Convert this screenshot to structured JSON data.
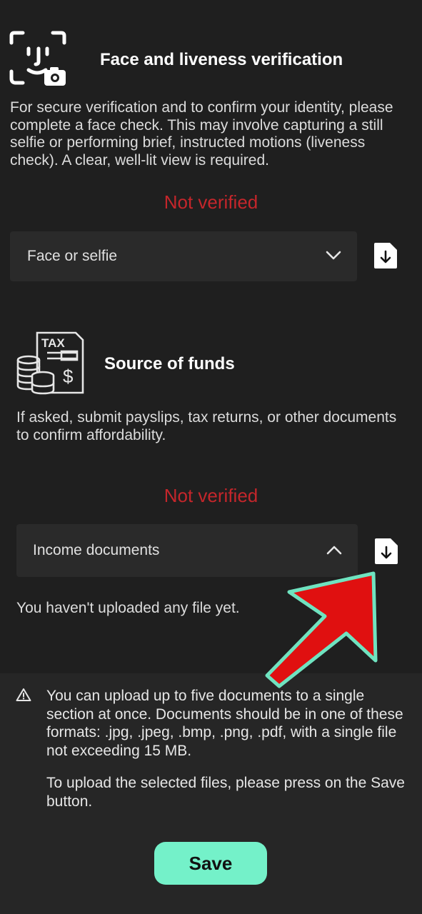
{
  "face": {
    "title": "Face and liveness verification",
    "description": "For secure verification and to confirm your identity, please complete a face check. This may involve capturing a still selfie or performing brief, instructed motions (liveness check). A clear, well-lit view is required.",
    "status": "Not verified",
    "select_value": "Face or selfie"
  },
  "funds": {
    "title": "Source of funds",
    "icon_text": "TAX",
    "description": "If asked, submit payslips, tax returns, or other documents to confirm affordability.",
    "status": "Not verified",
    "select_value": "Income documents",
    "empty_message": "You haven't uploaded any file yet."
  },
  "notice": {
    "line1": "You can upload up to five documents to a single section at once. Documents should be in one of these formats: .jpg, .jpeg, .bmp, .png, .pdf, with a single file not exceeding 15 MB.",
    "line2": "To upload the selected files, please press on the Save button."
  },
  "save_label": "Save",
  "colors": {
    "background": "#1f1f1f",
    "status_red": "#c4262b",
    "save_green": "#74f1c9",
    "arrow_red": "#e01010",
    "arrow_outline": "#6fe3c0"
  }
}
